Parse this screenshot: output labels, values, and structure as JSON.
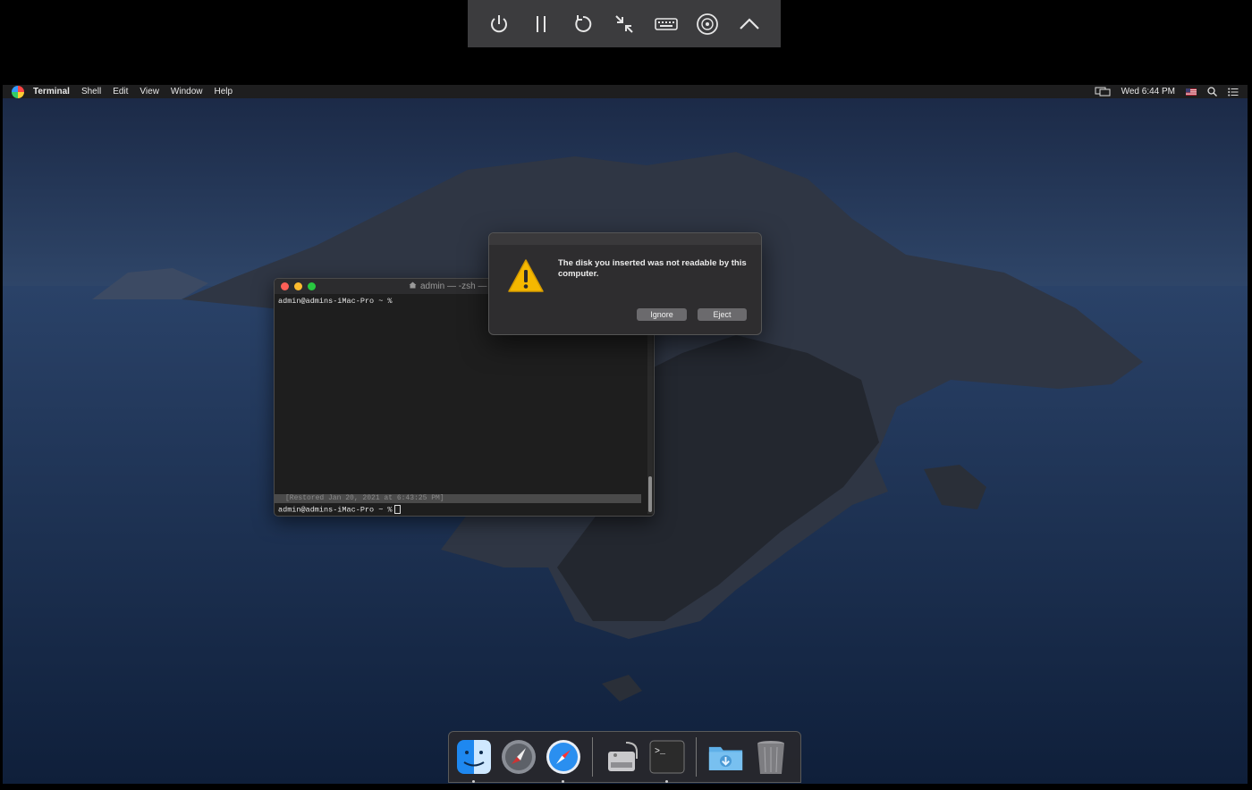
{
  "vm_toolbar": {
    "buttons": [
      "power-icon",
      "pause-icon",
      "restart-icon",
      "exit-fullscreen-icon",
      "keyboard-icon",
      "disc-icon",
      "collapse-icon"
    ]
  },
  "menubar": {
    "app_name": "Terminal",
    "items": [
      "Shell",
      "Edit",
      "View",
      "Window",
      "Help"
    ],
    "clock": "Wed 6:44 PM"
  },
  "terminal": {
    "title": "admin — -zsh —",
    "first_prompt": "admin@admins-iMac-Pro ~ %",
    "restored": "[Restored Jan 20, 2021 at 6:43:25 PM]",
    "second_prompt": "admin@admins-iMac-Pro ~ %"
  },
  "alert": {
    "message": "The disk you inserted was not readable by this computer.",
    "ignore_label": "Ignore",
    "eject_label": "Eject"
  },
  "dock": {
    "apps": [
      "finder-icon",
      "launchpad-icon",
      "safari-icon",
      "disk-utility-icon",
      "terminal-icon",
      "downloads-folder-icon",
      "trash-icon"
    ]
  },
  "colors": {
    "accent_warning": "#f5b800",
    "close": "#fe5f57",
    "minimize": "#febc2e",
    "maximize": "#28c840"
  }
}
